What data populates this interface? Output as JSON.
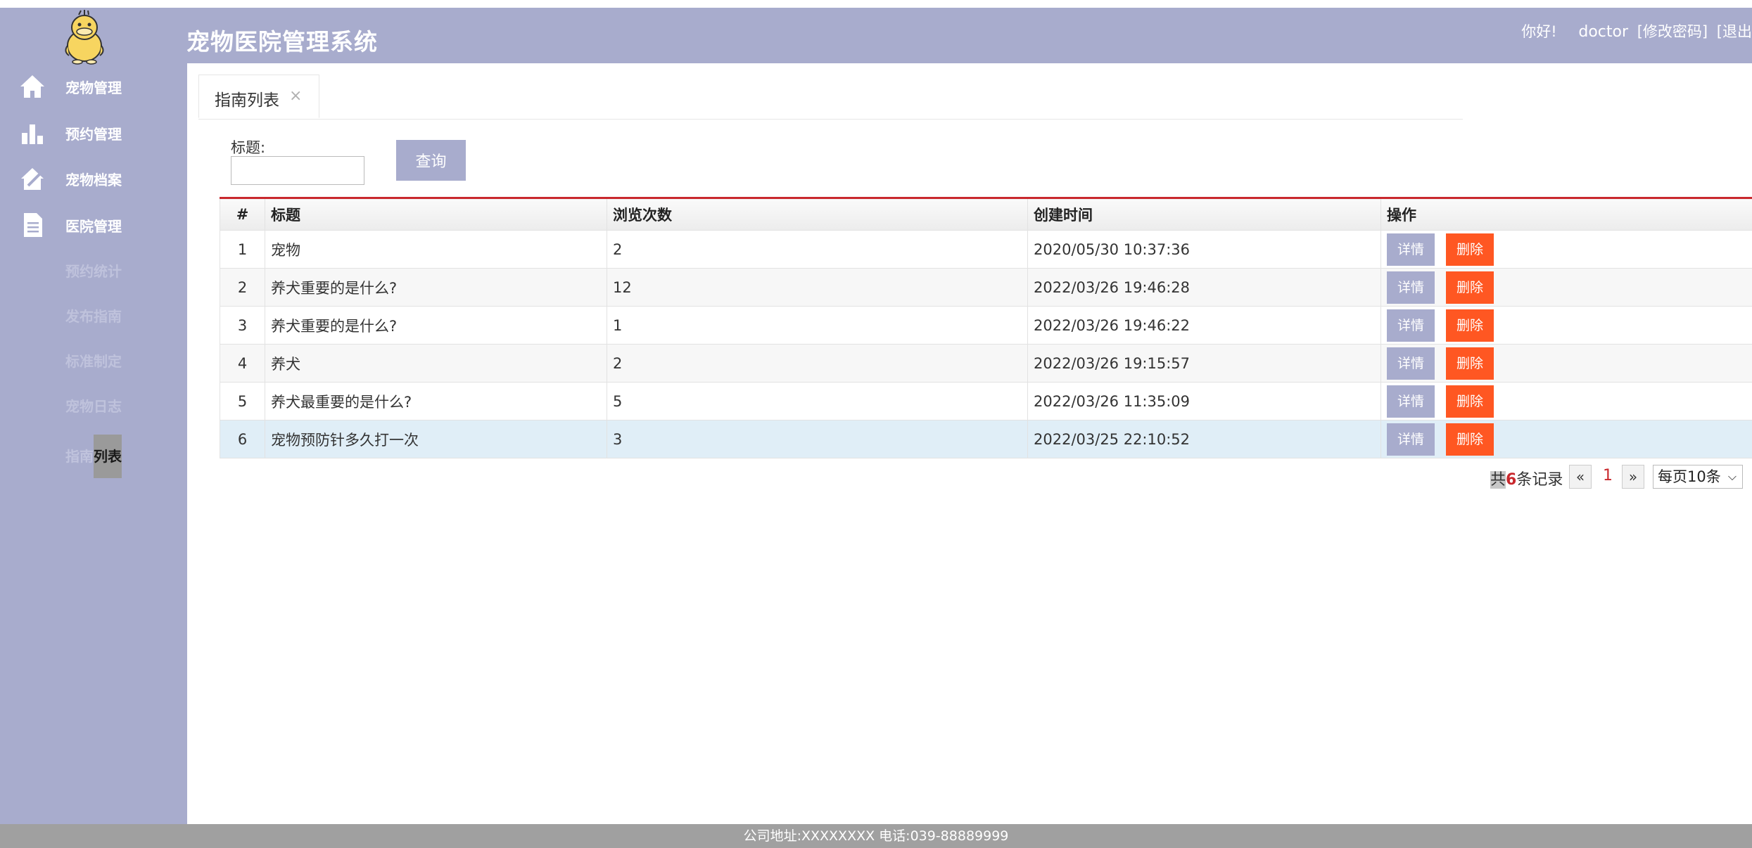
{
  "header": {
    "title": "宠物医院管理系统",
    "greeting": "你好!",
    "username": "doctor",
    "change_password": "[修改密码]",
    "logout": "[退出"
  },
  "sidebar": {
    "menu": [
      {
        "label": "宠物管理",
        "icon": "home-icon"
      },
      {
        "label": "预约管理",
        "icon": "bar-chart-icon"
      },
      {
        "label": "宠物档案",
        "icon": "pet-house-icon"
      },
      {
        "label": "医院管理",
        "icon": "document-icon"
      }
    ],
    "submenu": [
      "预约统计",
      "发布指南",
      "标准制定",
      "宠物日志"
    ],
    "active_prefix": "指南",
    "active_suffix": "列表"
  },
  "tabs": [
    {
      "label": "指南列表",
      "close": "×"
    }
  ],
  "search": {
    "label": "标题:",
    "value": "",
    "button": "查询"
  },
  "table": {
    "columns": [
      "#",
      "标题",
      "浏览次数",
      "创建时间",
      "操作"
    ],
    "rows": [
      {
        "no": "1",
        "title": "宠物",
        "views": "2",
        "created": "2020/05/30 10:37:36"
      },
      {
        "no": "2",
        "title": "养犬重要的是什么?",
        "views": "12",
        "created": "2022/03/26 19:46:28"
      },
      {
        "no": "3",
        "title": "养犬重要的是什么?",
        "views": "1",
        "created": "2022/03/26 19:46:22"
      },
      {
        "no": "4",
        "title": "养犬",
        "views": "2",
        "created": "2022/03/26 19:15:57"
      },
      {
        "no": "5",
        "title": "养犬最重要的是什么?",
        "views": "5",
        "created": "2022/03/26 11:35:09"
      },
      {
        "no": "6",
        "title": "宠物预防针多久打一次",
        "views": "3",
        "created": "2022/03/25 22:10:52"
      }
    ],
    "detail_label": "详情",
    "delete_label": "删除"
  },
  "pager": {
    "prefix": "共",
    "count": "6",
    "suffix": "条记录",
    "prev": "«",
    "current": "1",
    "next": "»",
    "page_size": "每页10条"
  },
  "footer": {
    "text": "公司地址:XXXXXXXX 电话:039-88889999"
  },
  "colors": {
    "theme": "#a8accd",
    "danger": "#ff5722",
    "accent_line": "#c9282d",
    "selected_row": "#e0eef7"
  }
}
